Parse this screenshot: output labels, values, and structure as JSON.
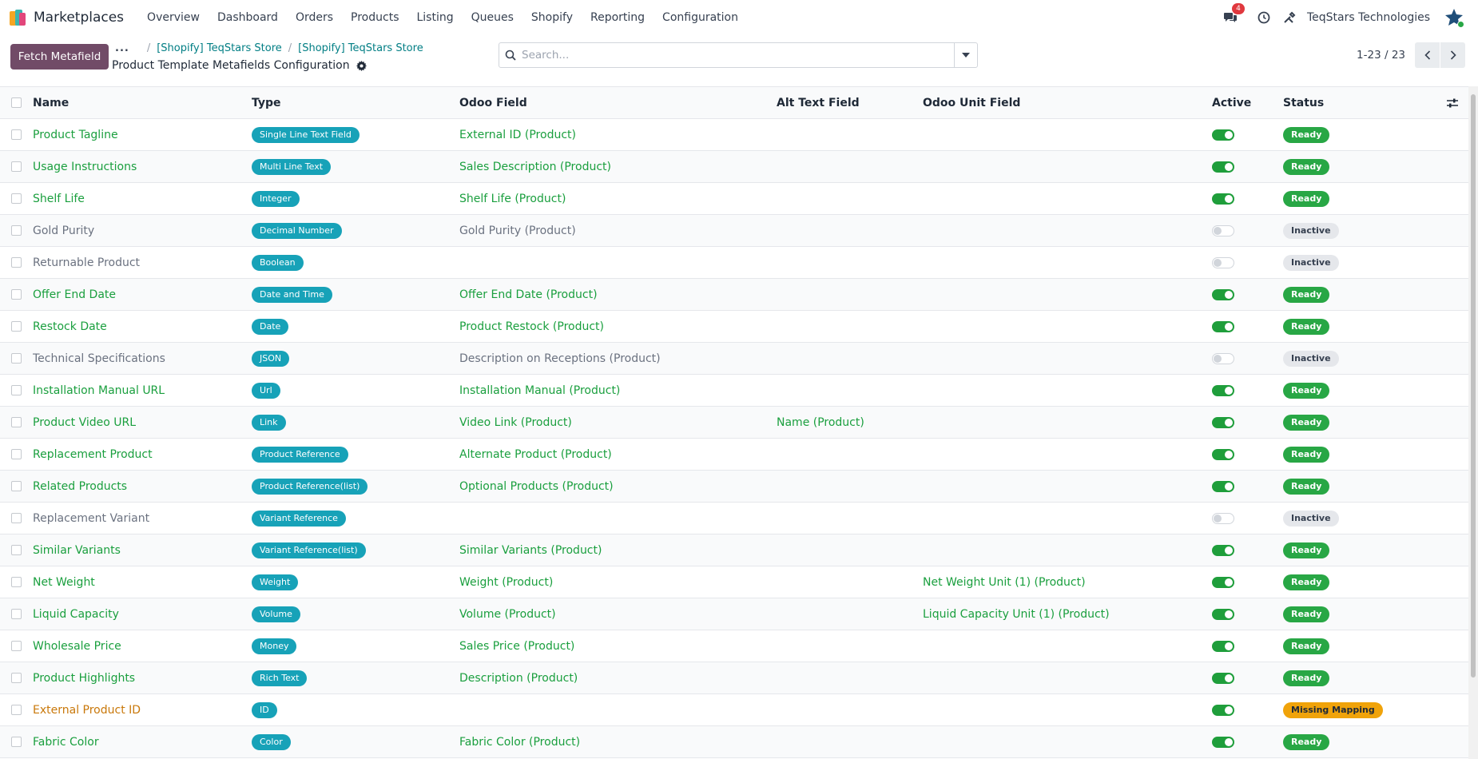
{
  "navbar": {
    "app_name": "Marketplaces",
    "menu": [
      "Overview",
      "Dashboard",
      "Orders",
      "Products",
      "Listing",
      "Queues",
      "Shopify",
      "Reporting",
      "Configuration"
    ],
    "message_count": "4",
    "company": "TeqStars Technologies"
  },
  "control_panel": {
    "primary_button": "Fetch Metafield",
    "breadcrumb_dots": "...",
    "breadcrumbs": [
      "[Shopify] TeqStars Store",
      "[Shopify] TeqStars Store"
    ],
    "page_title": "Product Template Metafields Configuration",
    "search_placeholder": "Search...",
    "pager": "1-23 / 23"
  },
  "table": {
    "columns": {
      "name": "Name",
      "type": "Type",
      "odoo_field": "Odoo Field",
      "alt_text_field": "Alt Text Field",
      "odoo_unit_field": "Odoo Unit Field",
      "active": "Active",
      "status": "Status"
    },
    "rows": [
      {
        "name": "Product Tagline",
        "type": "Single Line Text Field",
        "odoo_field": "External ID (Product)",
        "alt_text": "",
        "unit_field": "",
        "active": true,
        "status": "Ready"
      },
      {
        "name": "Usage Instructions",
        "type": "Multi Line Text",
        "odoo_field": "Sales Description (Product)",
        "alt_text": "",
        "unit_field": "",
        "active": true,
        "status": "Ready"
      },
      {
        "name": "Shelf Life",
        "type": "Integer",
        "odoo_field": "Shelf Life (Product)",
        "alt_text": "",
        "unit_field": "",
        "active": true,
        "status": "Ready"
      },
      {
        "name": "Gold Purity",
        "type": "Decimal Number",
        "odoo_field": "Gold Purity (Product)",
        "alt_text": "",
        "unit_field": "",
        "active": false,
        "status": "Inactive"
      },
      {
        "name": "Returnable Product",
        "type": "Boolean",
        "odoo_field": "",
        "alt_text": "",
        "unit_field": "",
        "active": false,
        "status": "Inactive"
      },
      {
        "name": "Offer End Date",
        "type": "Date and Time",
        "odoo_field": "Offer End Date (Product)",
        "alt_text": "",
        "unit_field": "",
        "active": true,
        "status": "Ready"
      },
      {
        "name": "Restock Date",
        "type": "Date",
        "odoo_field": "Product Restock (Product)",
        "alt_text": "",
        "unit_field": "",
        "active": true,
        "status": "Ready"
      },
      {
        "name": "Technical Specifications",
        "type": "JSON",
        "odoo_field": "Description on Receptions (Product)",
        "alt_text": "",
        "unit_field": "",
        "active": false,
        "status": "Inactive"
      },
      {
        "name": "Installation Manual URL",
        "type": "Url",
        "odoo_field": "Installation Manual (Product)",
        "alt_text": "",
        "unit_field": "",
        "active": true,
        "status": "Ready"
      },
      {
        "name": "Product Video URL",
        "type": "Link",
        "odoo_field": "Video Link (Product)",
        "alt_text": "Name (Product)",
        "unit_field": "",
        "active": true,
        "status": "Ready"
      },
      {
        "name": "Replacement Product",
        "type": "Product Reference",
        "odoo_field": "Alternate Product (Product)",
        "alt_text": "",
        "unit_field": "",
        "active": true,
        "status": "Ready"
      },
      {
        "name": "Related Products",
        "type": "Product Reference(list)",
        "odoo_field": "Optional Products (Product)",
        "alt_text": "",
        "unit_field": "",
        "active": true,
        "status": "Ready"
      },
      {
        "name": "Replacement Variant",
        "type": "Variant Reference",
        "odoo_field": "",
        "alt_text": "",
        "unit_field": "",
        "active": false,
        "status": "Inactive"
      },
      {
        "name": "Similar Variants",
        "type": "Variant Reference(list)",
        "odoo_field": "Similar Variants (Product)",
        "alt_text": "",
        "unit_field": "",
        "active": true,
        "status": "Ready"
      },
      {
        "name": "Net Weight",
        "type": "Weight",
        "odoo_field": "Weight (Product)",
        "alt_text": "",
        "unit_field": "Net Weight Unit (1) (Product)",
        "active": true,
        "status": "Ready"
      },
      {
        "name": "Liquid Capacity",
        "type": "Volume",
        "odoo_field": "Volume (Product)",
        "alt_text": "",
        "unit_field": "Liquid Capacity Unit (1) (Product)",
        "active": true,
        "status": "Ready"
      },
      {
        "name": "Wholesale Price",
        "type": "Money",
        "odoo_field": "Sales Price (Product)",
        "alt_text": "",
        "unit_field": "",
        "active": true,
        "status": "Ready"
      },
      {
        "name": "Product Highlights",
        "type": "Rich Text",
        "odoo_field": "Description (Product)",
        "alt_text": "",
        "unit_field": "",
        "active": true,
        "status": "Ready"
      },
      {
        "name": "External Product ID",
        "type": "ID",
        "odoo_field": "",
        "alt_text": "",
        "unit_field": "",
        "active": true,
        "status": "Missing Mapping"
      },
      {
        "name": "Fabric Color",
        "type": "Color",
        "odoo_field": "Fabric Color (Product)",
        "alt_text": "",
        "unit_field": "",
        "active": true,
        "status": "Ready"
      }
    ]
  },
  "colors": {
    "brand": "#714b67",
    "link": "#017e84",
    "ready_text": "#1a9f3e",
    "inactive_text": "#6b7280",
    "missing_text": "#c9780a",
    "type_tag": "#17a2b8",
    "ready_badge": "#28a745",
    "missing_badge": "#f0a30a"
  }
}
